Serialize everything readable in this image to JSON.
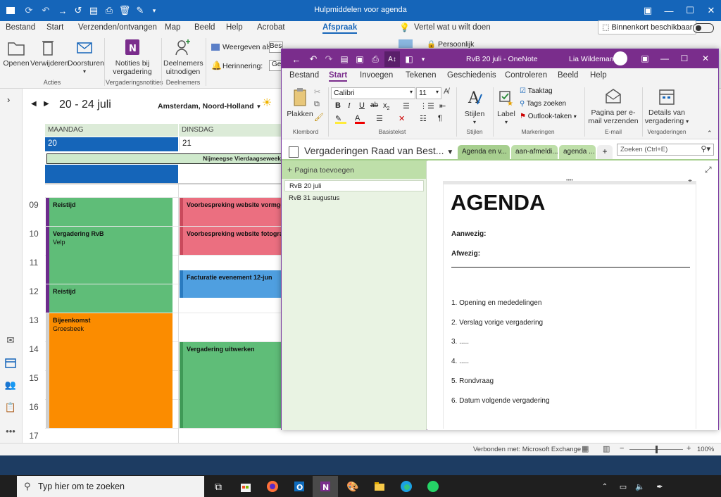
{
  "outlook": {
    "title": "Hulpmiddelen voor agenda",
    "menu": [
      "Bestand",
      "Start",
      "Verzenden/ontvangen",
      "Map",
      "Beeld",
      "Help",
      "Acrobat",
      "Afspraak"
    ],
    "tell_me": "Vertel wat u wilt doen",
    "coming_soon": "Binnenkort beschikbaar",
    "ribbon": {
      "open": "Openen",
      "delete": "Verwijderen",
      "forward": "Doorsturen",
      "actions_group": "Acties",
      "notes_line1": "Notities bij",
      "notes_line2": "vergadering",
      "notes_group": "Vergaderingsnotities",
      "attendees_line1": "Deelnemers",
      "attendees_line2": "uitnodigen",
      "attendees_group": "Deelnemers",
      "show_as": "Weergeven als:",
      "show_as_value": "Beschikbaar",
      "reminder": "Herinnering:",
      "reminder_value": "Geen",
      "private": "Persoonlijk"
    },
    "calendar": {
      "date_range": "20 - 24 juli",
      "location": "Amsterdam, Noord-Holland",
      "days": [
        {
          "name": "MAANDAG",
          "num": "20"
        },
        {
          "name": "DINSDAG",
          "num": "21"
        }
      ],
      "banner": "Nijmeegse Vierdaagseweek",
      "hours": [
        "09",
        "10",
        "11",
        "12",
        "13",
        "14",
        "15",
        "16",
        "17"
      ],
      "monday": [
        {
          "title": "Reistijd",
          "sub": ""
        },
        {
          "title": "Vergadering RvB",
          "sub": "Velp"
        },
        {
          "title": "Reistijd",
          "sub": ""
        },
        {
          "title": "Bijeenkomst",
          "sub": "Groesbeek"
        }
      ],
      "tuesday": [
        {
          "title": "Voorbespreking website vormgeving",
          "sub": ""
        },
        {
          "title": "Voorbespreking website fotografie |",
          "sub": ""
        },
        {
          "title": "Facturatie evenement 12-jun",
          "sub": ""
        },
        {
          "title": "Vergadering uitwerken",
          "sub": ""
        }
      ]
    },
    "status": {
      "connection": "Verbonden met: Microsoft Exchange",
      "zoom": "100%",
      "zoom_level": 0.5
    }
  },
  "onenote": {
    "title": "RvB 20 juli  -  OneNote",
    "user": "Lia Wildeman",
    "menu": [
      "Bestand",
      "Start",
      "Invoegen",
      "Tekenen",
      "Geschiedenis",
      "Controleren",
      "Beeld",
      "Help"
    ],
    "ribbon": {
      "paste": "Plakken",
      "clipboard": "Klembord",
      "font": "Calibri",
      "size": "11",
      "basic_text": "Basistekst",
      "styles": "Stijlen",
      "styles_group": "Stijlen",
      "label": "Label",
      "todo": "Taaktag",
      "find_tags": "Tags zoeken",
      "outlook_tasks": "Outlook-taken",
      "tags_group": "Markeringen",
      "email_line1": "Pagina per e-",
      "email_line2": "mail verzenden",
      "email_group": "E-mail",
      "meeting_line1": "Details van",
      "meeting_line2": "vergadering",
      "meeting_group": "Vergaderingen",
      "bold": "B",
      "italic": "I",
      "underline": "U",
      "strike": "ab",
      "sub": "x"
    },
    "notebook": "Vergaderingen Raad van Best...",
    "tabs": [
      "Agenda en v...",
      "aan-afmeldi...",
      "agenda ..."
    ],
    "add_tab": "+",
    "search_placeholder": "Zoeken (Ctrl+E)",
    "add_page": "Pagina toevoegen",
    "pages": [
      "RvB 20 juli",
      "RvB 31 augustus"
    ],
    "page": {
      "heading": "AGENDA",
      "present": "Aanwezig:",
      "absent": "Afwezig:",
      "items": [
        "1. Opening en mededelingen",
        "2. Verslag vorige vergadering",
        "3. .....",
        "4. .....",
        "5. Rondvraag",
        "6. Datum volgende vergadering"
      ]
    }
  },
  "taskbar": {
    "search_placeholder": "Typ hier om te zoeken"
  },
  "colors": {
    "outlook_blue": "#1565b9",
    "onenote_purple": "#7a2d8c",
    "event_green": "#5fbd78",
    "event_pink": "#eb6f80",
    "event_blue": "#4f9fe0",
    "event_orange": "#fb8c00"
  }
}
